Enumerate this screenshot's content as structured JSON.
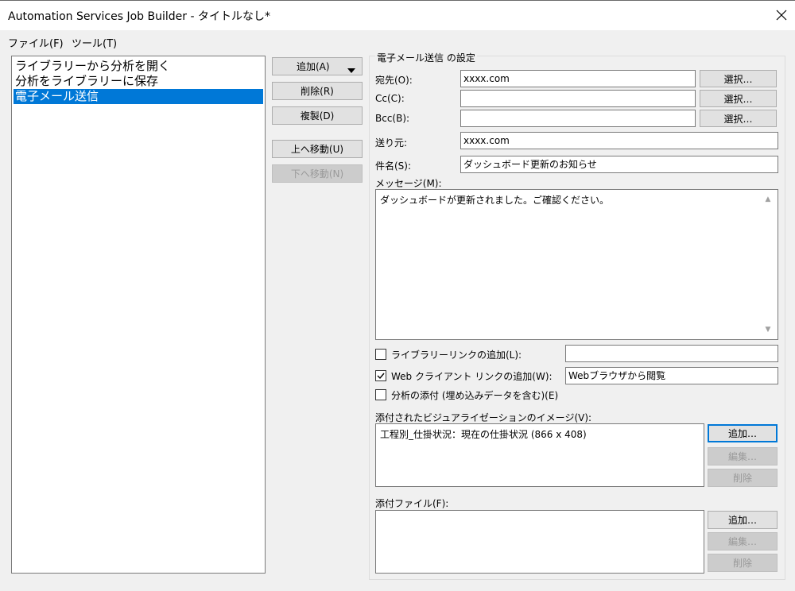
{
  "window": {
    "title": "Automation Services Job Builder - タイトルなし*"
  },
  "menu": {
    "file": "ファイル(F)",
    "tools": "ツール(T)"
  },
  "task_list": {
    "items": [
      {
        "label": "ライブラリーから分析を開く",
        "selected": false
      },
      {
        "label": "分析をライブラリーに保存",
        "selected": false
      },
      {
        "label": "電子メール送信",
        "selected": true
      }
    ]
  },
  "task_buttons": {
    "add": "追加(A)",
    "delete": "削除(R)",
    "duplicate": "複製(D)",
    "move_up": "上へ移動(U)",
    "move_down": "下へ移動(N)"
  },
  "email": {
    "group_title": "電子メール送信 の設定",
    "to_label": "宛先(O):",
    "to_value": "xxxx.com",
    "cc_label": "Cc(C):",
    "cc_value": "",
    "bcc_label": "Bcc(B):",
    "bcc_value": "",
    "select_label": "選択…",
    "from_label": "送り元:",
    "from_value": "xxxx.com",
    "subject_label": "件名(S):",
    "subject_value": "ダッシュボード更新のお知らせ",
    "message_label": "メッセージ(M):",
    "message_value": "ダッシュボードが更新されました。ご確認ください。",
    "library_link": {
      "label": "ライブラリーリンクの追加(L):",
      "checked": false,
      "value": ""
    },
    "web_link": {
      "label": "Web クライアント リンクの追加(W):",
      "checked": true,
      "value": "Webブラウザから閲覧"
    },
    "attach_analysis": {
      "label": "分析の添付 (埋め込みデータを含む)(E)",
      "checked": false
    },
    "viz_label": "添付されたビジュアライゼーションのイメージ(V):",
    "viz_items": [
      "工程別_仕掛状況：現在の仕掛状況 (866 x 408)"
    ],
    "files_label": "添付ファイル(F):",
    "files_items": [],
    "add_label": "追加…",
    "edit_label": "編集…",
    "remove_label": "削除"
  }
}
